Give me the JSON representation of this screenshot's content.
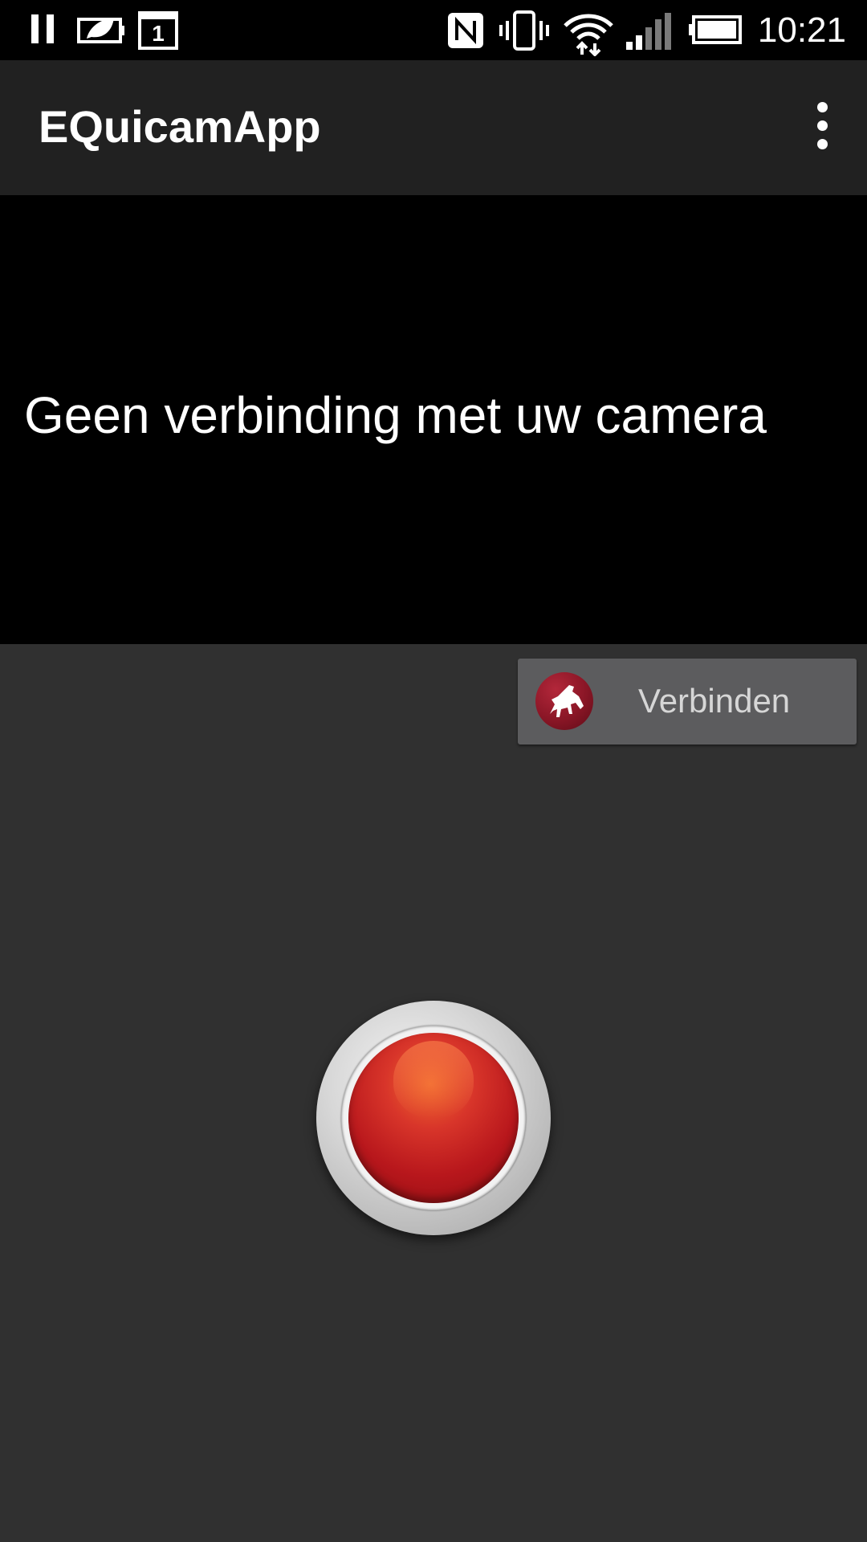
{
  "status_bar": {
    "time": "10:21",
    "left_icons": [
      "pause-icon",
      "battery-saver-icon",
      "calendar-icon"
    ],
    "calendar_day": "1",
    "right_icons": [
      "nfc-icon",
      "vibrate-icon",
      "wifi-icon",
      "signal-icon",
      "battery-icon"
    ]
  },
  "app_bar": {
    "title": "EQuicamApp",
    "menu_icon": "overflow-menu-icon"
  },
  "camera": {
    "message": "Geen verbinding met uw camera"
  },
  "connect": {
    "label": "Verbinden",
    "icon": "horse-logo-icon",
    "logo_color": "#8a1626"
  },
  "record": {
    "icon": "record-button-icon",
    "color": "#c41f22"
  },
  "colors": {
    "status_bar": "#000000",
    "app_bar": "#212121",
    "camera_bg": "#000000",
    "body_bg": "#303030",
    "connect_bg": "#5c5c5e"
  }
}
